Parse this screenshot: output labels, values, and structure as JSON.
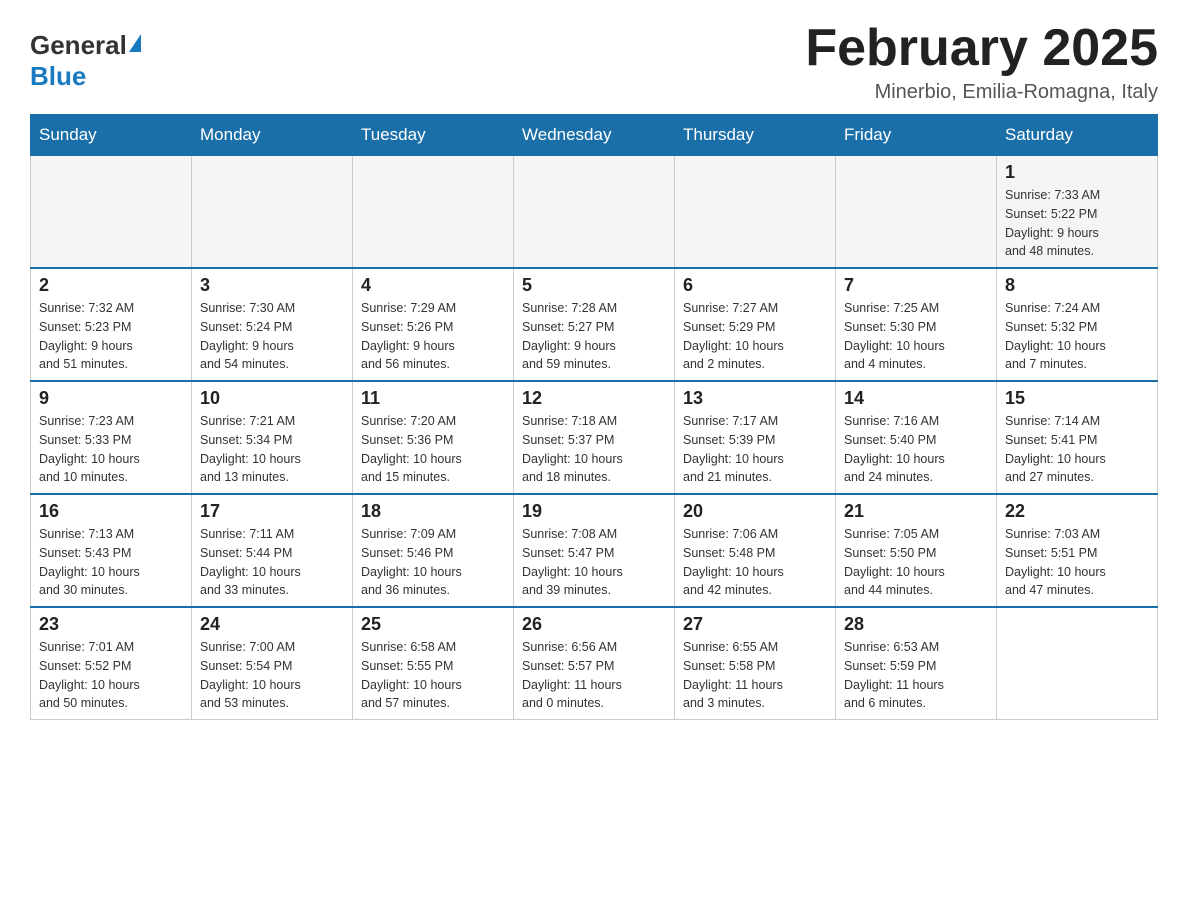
{
  "logo": {
    "general": "General",
    "blue": "Blue"
  },
  "title": "February 2025",
  "location": "Minerbio, Emilia-Romagna, Italy",
  "days_header": [
    "Sunday",
    "Monday",
    "Tuesday",
    "Wednesday",
    "Thursday",
    "Friday",
    "Saturday"
  ],
  "weeks": [
    [
      {
        "day": "",
        "info": ""
      },
      {
        "day": "",
        "info": ""
      },
      {
        "day": "",
        "info": ""
      },
      {
        "day": "",
        "info": ""
      },
      {
        "day": "",
        "info": ""
      },
      {
        "day": "",
        "info": ""
      },
      {
        "day": "1",
        "info": "Sunrise: 7:33 AM\nSunset: 5:22 PM\nDaylight: 9 hours\nand 48 minutes."
      }
    ],
    [
      {
        "day": "2",
        "info": "Sunrise: 7:32 AM\nSunset: 5:23 PM\nDaylight: 9 hours\nand 51 minutes."
      },
      {
        "day": "3",
        "info": "Sunrise: 7:30 AM\nSunset: 5:24 PM\nDaylight: 9 hours\nand 54 minutes."
      },
      {
        "day": "4",
        "info": "Sunrise: 7:29 AM\nSunset: 5:26 PM\nDaylight: 9 hours\nand 56 minutes."
      },
      {
        "day": "5",
        "info": "Sunrise: 7:28 AM\nSunset: 5:27 PM\nDaylight: 9 hours\nand 59 minutes."
      },
      {
        "day": "6",
        "info": "Sunrise: 7:27 AM\nSunset: 5:29 PM\nDaylight: 10 hours\nand 2 minutes."
      },
      {
        "day": "7",
        "info": "Sunrise: 7:25 AM\nSunset: 5:30 PM\nDaylight: 10 hours\nand 4 minutes."
      },
      {
        "day": "8",
        "info": "Sunrise: 7:24 AM\nSunset: 5:32 PM\nDaylight: 10 hours\nand 7 minutes."
      }
    ],
    [
      {
        "day": "9",
        "info": "Sunrise: 7:23 AM\nSunset: 5:33 PM\nDaylight: 10 hours\nand 10 minutes."
      },
      {
        "day": "10",
        "info": "Sunrise: 7:21 AM\nSunset: 5:34 PM\nDaylight: 10 hours\nand 13 minutes."
      },
      {
        "day": "11",
        "info": "Sunrise: 7:20 AM\nSunset: 5:36 PM\nDaylight: 10 hours\nand 15 minutes."
      },
      {
        "day": "12",
        "info": "Sunrise: 7:18 AM\nSunset: 5:37 PM\nDaylight: 10 hours\nand 18 minutes."
      },
      {
        "day": "13",
        "info": "Sunrise: 7:17 AM\nSunset: 5:39 PM\nDaylight: 10 hours\nand 21 minutes."
      },
      {
        "day": "14",
        "info": "Sunrise: 7:16 AM\nSunset: 5:40 PM\nDaylight: 10 hours\nand 24 minutes."
      },
      {
        "day": "15",
        "info": "Sunrise: 7:14 AM\nSunset: 5:41 PM\nDaylight: 10 hours\nand 27 minutes."
      }
    ],
    [
      {
        "day": "16",
        "info": "Sunrise: 7:13 AM\nSunset: 5:43 PM\nDaylight: 10 hours\nand 30 minutes."
      },
      {
        "day": "17",
        "info": "Sunrise: 7:11 AM\nSunset: 5:44 PM\nDaylight: 10 hours\nand 33 minutes."
      },
      {
        "day": "18",
        "info": "Sunrise: 7:09 AM\nSunset: 5:46 PM\nDaylight: 10 hours\nand 36 minutes."
      },
      {
        "day": "19",
        "info": "Sunrise: 7:08 AM\nSunset: 5:47 PM\nDaylight: 10 hours\nand 39 minutes."
      },
      {
        "day": "20",
        "info": "Sunrise: 7:06 AM\nSunset: 5:48 PM\nDaylight: 10 hours\nand 42 minutes."
      },
      {
        "day": "21",
        "info": "Sunrise: 7:05 AM\nSunset: 5:50 PM\nDaylight: 10 hours\nand 44 minutes."
      },
      {
        "day": "22",
        "info": "Sunrise: 7:03 AM\nSunset: 5:51 PM\nDaylight: 10 hours\nand 47 minutes."
      }
    ],
    [
      {
        "day": "23",
        "info": "Sunrise: 7:01 AM\nSunset: 5:52 PM\nDaylight: 10 hours\nand 50 minutes."
      },
      {
        "day": "24",
        "info": "Sunrise: 7:00 AM\nSunset: 5:54 PM\nDaylight: 10 hours\nand 53 minutes."
      },
      {
        "day": "25",
        "info": "Sunrise: 6:58 AM\nSunset: 5:55 PM\nDaylight: 10 hours\nand 57 minutes."
      },
      {
        "day": "26",
        "info": "Sunrise: 6:56 AM\nSunset: 5:57 PM\nDaylight: 11 hours\nand 0 minutes."
      },
      {
        "day": "27",
        "info": "Sunrise: 6:55 AM\nSunset: 5:58 PM\nDaylight: 11 hours\nand 3 minutes."
      },
      {
        "day": "28",
        "info": "Sunrise: 6:53 AM\nSunset: 5:59 PM\nDaylight: 11 hours\nand 6 minutes."
      },
      {
        "day": "",
        "info": ""
      }
    ]
  ]
}
